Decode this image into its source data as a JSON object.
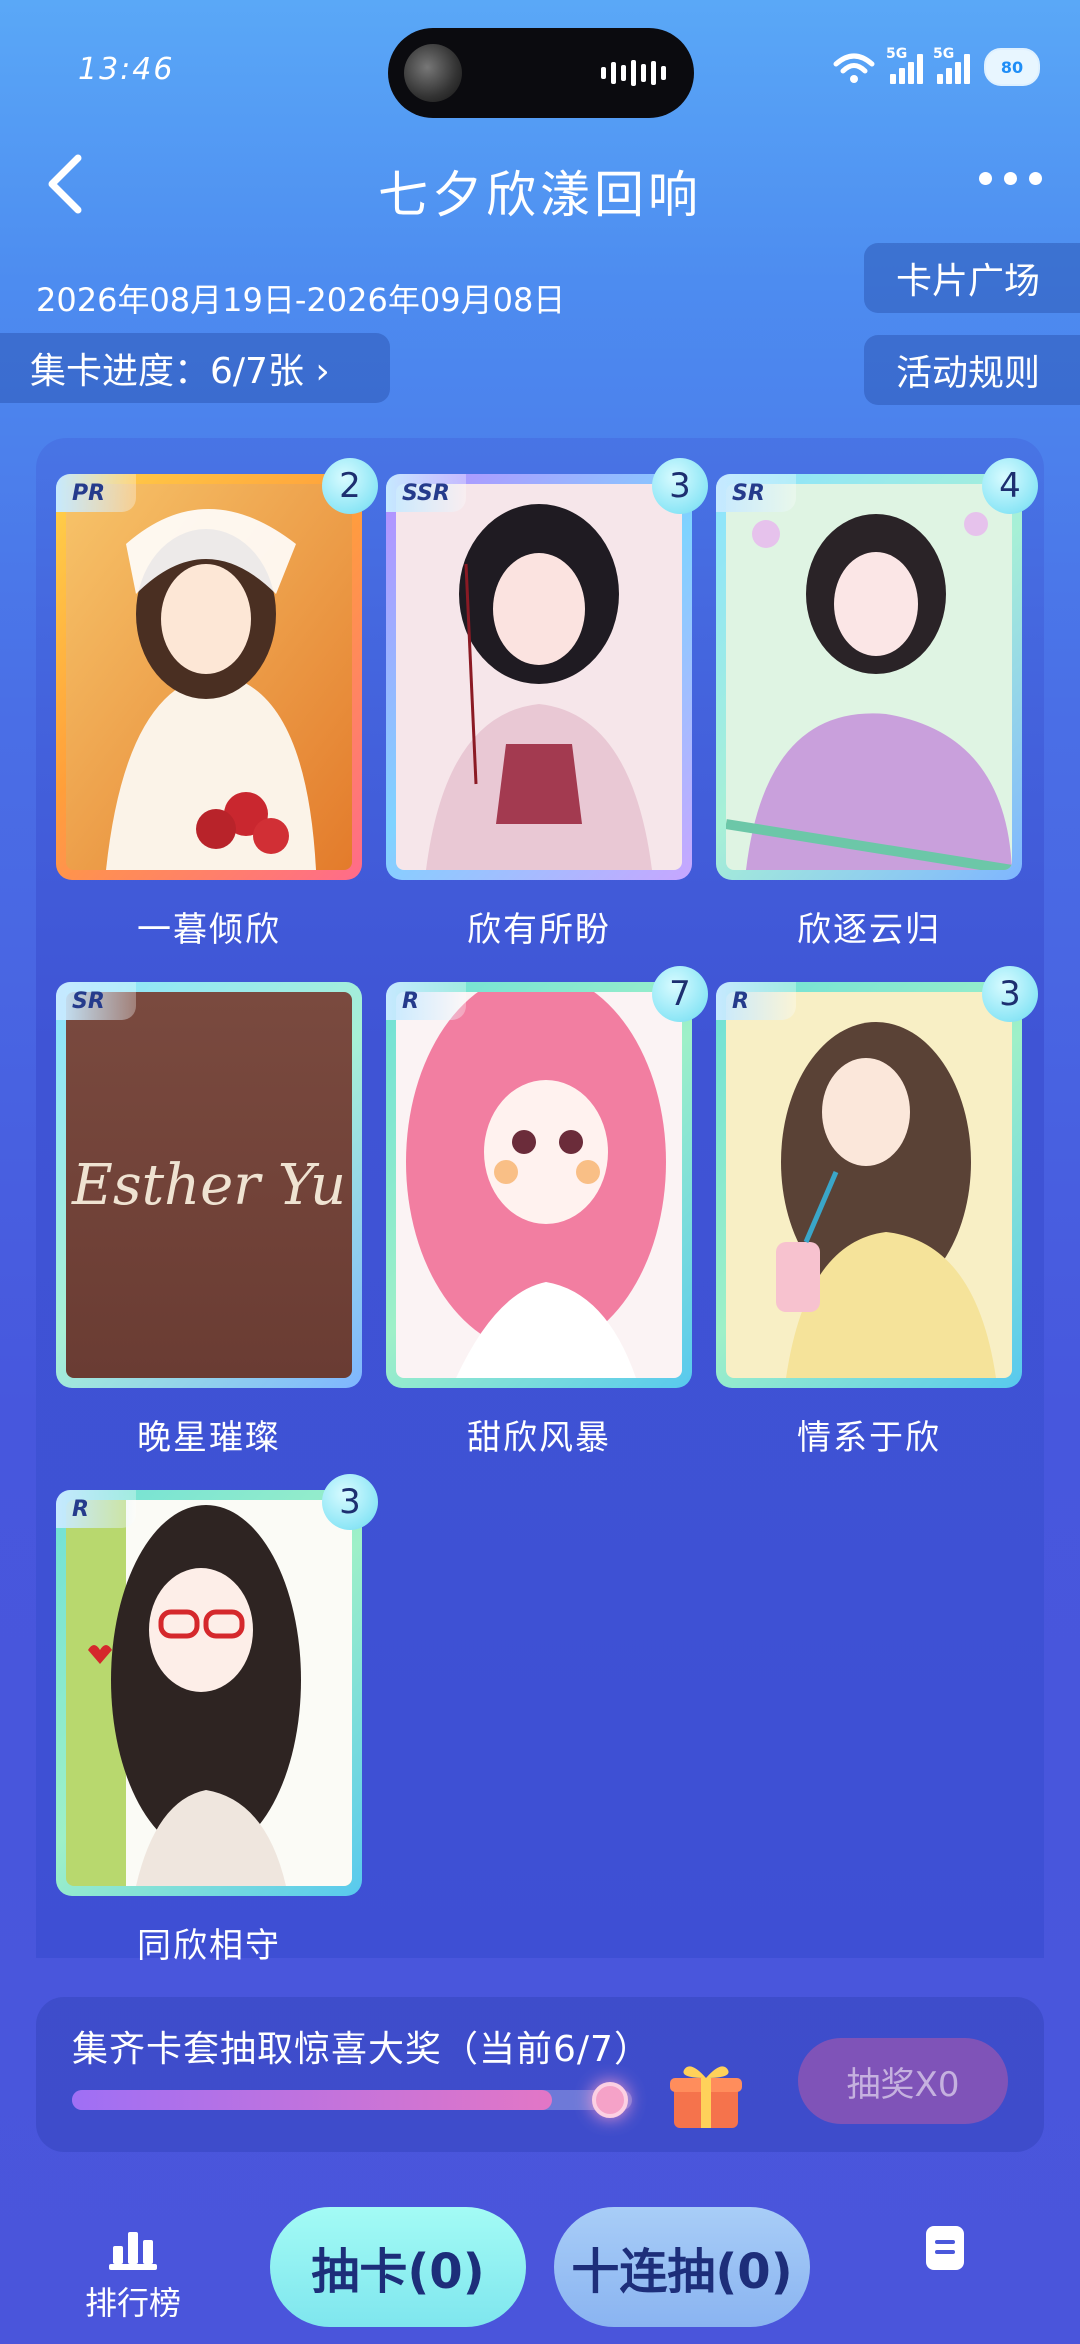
{
  "status": {
    "time": "13:46",
    "battery": "80",
    "signal1": "5G",
    "signal2": "5G"
  },
  "header": {
    "title": "七夕欣漾回响"
  },
  "info": {
    "date_range": "2026年08月19日-2026年09月08日",
    "progress": "集卡进度：6/7张 ›"
  },
  "buttons": {
    "card_square": "卡片广场",
    "rules": "活动规则"
  },
  "cards": [
    {
      "rarity": "PR",
      "count": "2",
      "name": "一暮倾欣"
    },
    {
      "rarity": "SSR",
      "count": "3",
      "name": "欣有所盼"
    },
    {
      "rarity": "SR",
      "count": "4",
      "name": "欣逐云归"
    },
    {
      "rarity": "SR",
      "count": "",
      "name": "晚星璀璨",
      "art_text": "Esther Yu"
    },
    {
      "rarity": "R",
      "count": "7",
      "name": "甜欣风暴"
    },
    {
      "rarity": "R",
      "count": "3",
      "name": "情系于欣"
    },
    {
      "rarity": "R",
      "count": "3",
      "name": "同欣相守"
    }
  ],
  "prize": {
    "text": "集齐卡套抽取惊喜大奖（当前6/7）",
    "progress": 0.857,
    "draw_label": "抽奖X0"
  },
  "bottom": {
    "rank_label": "排行榜",
    "draw_one": "抽卡(0)",
    "draw_ten": "十连抽(0)"
  },
  "colors": {
    "accent_cyan": "#8de6f6",
    "panel": "#3f54d5"
  }
}
